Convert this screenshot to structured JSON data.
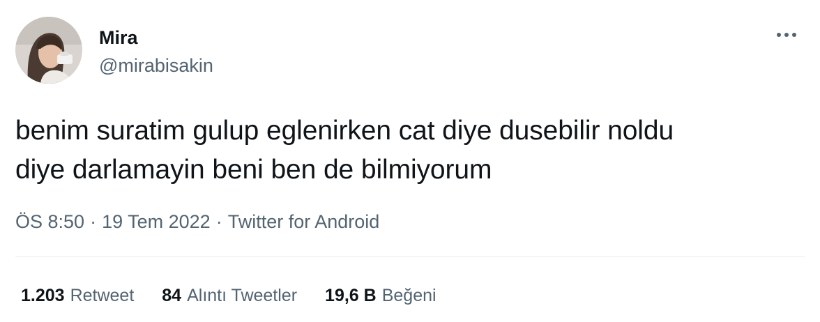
{
  "author": {
    "display_name": "Mira",
    "handle": "@mirabisakin",
    "avatar_icon": "profile-photo"
  },
  "menu_icon": "more-horizontal-icon",
  "tweet": {
    "line1": "benim suratim gulup eglenirken cat diye dusebilir noldu",
    "line2": "diye darlamayin beni ben de bilmiyorum"
  },
  "meta": {
    "time": "ÖS 8:50",
    "separator": "·",
    "date": "19 Tem 2022",
    "source": "Twitter for Android"
  },
  "stats": {
    "retweets": {
      "count": "1.203",
      "label": "Retweet"
    },
    "quotes": {
      "count": "84",
      "label": "Alıntı Tweetler"
    },
    "likes": {
      "count": "19,6 B",
      "label": "Beğeni"
    }
  },
  "colors": {
    "text": "#0f1419",
    "secondary": "#536471",
    "divider": "#e6ecf0"
  }
}
